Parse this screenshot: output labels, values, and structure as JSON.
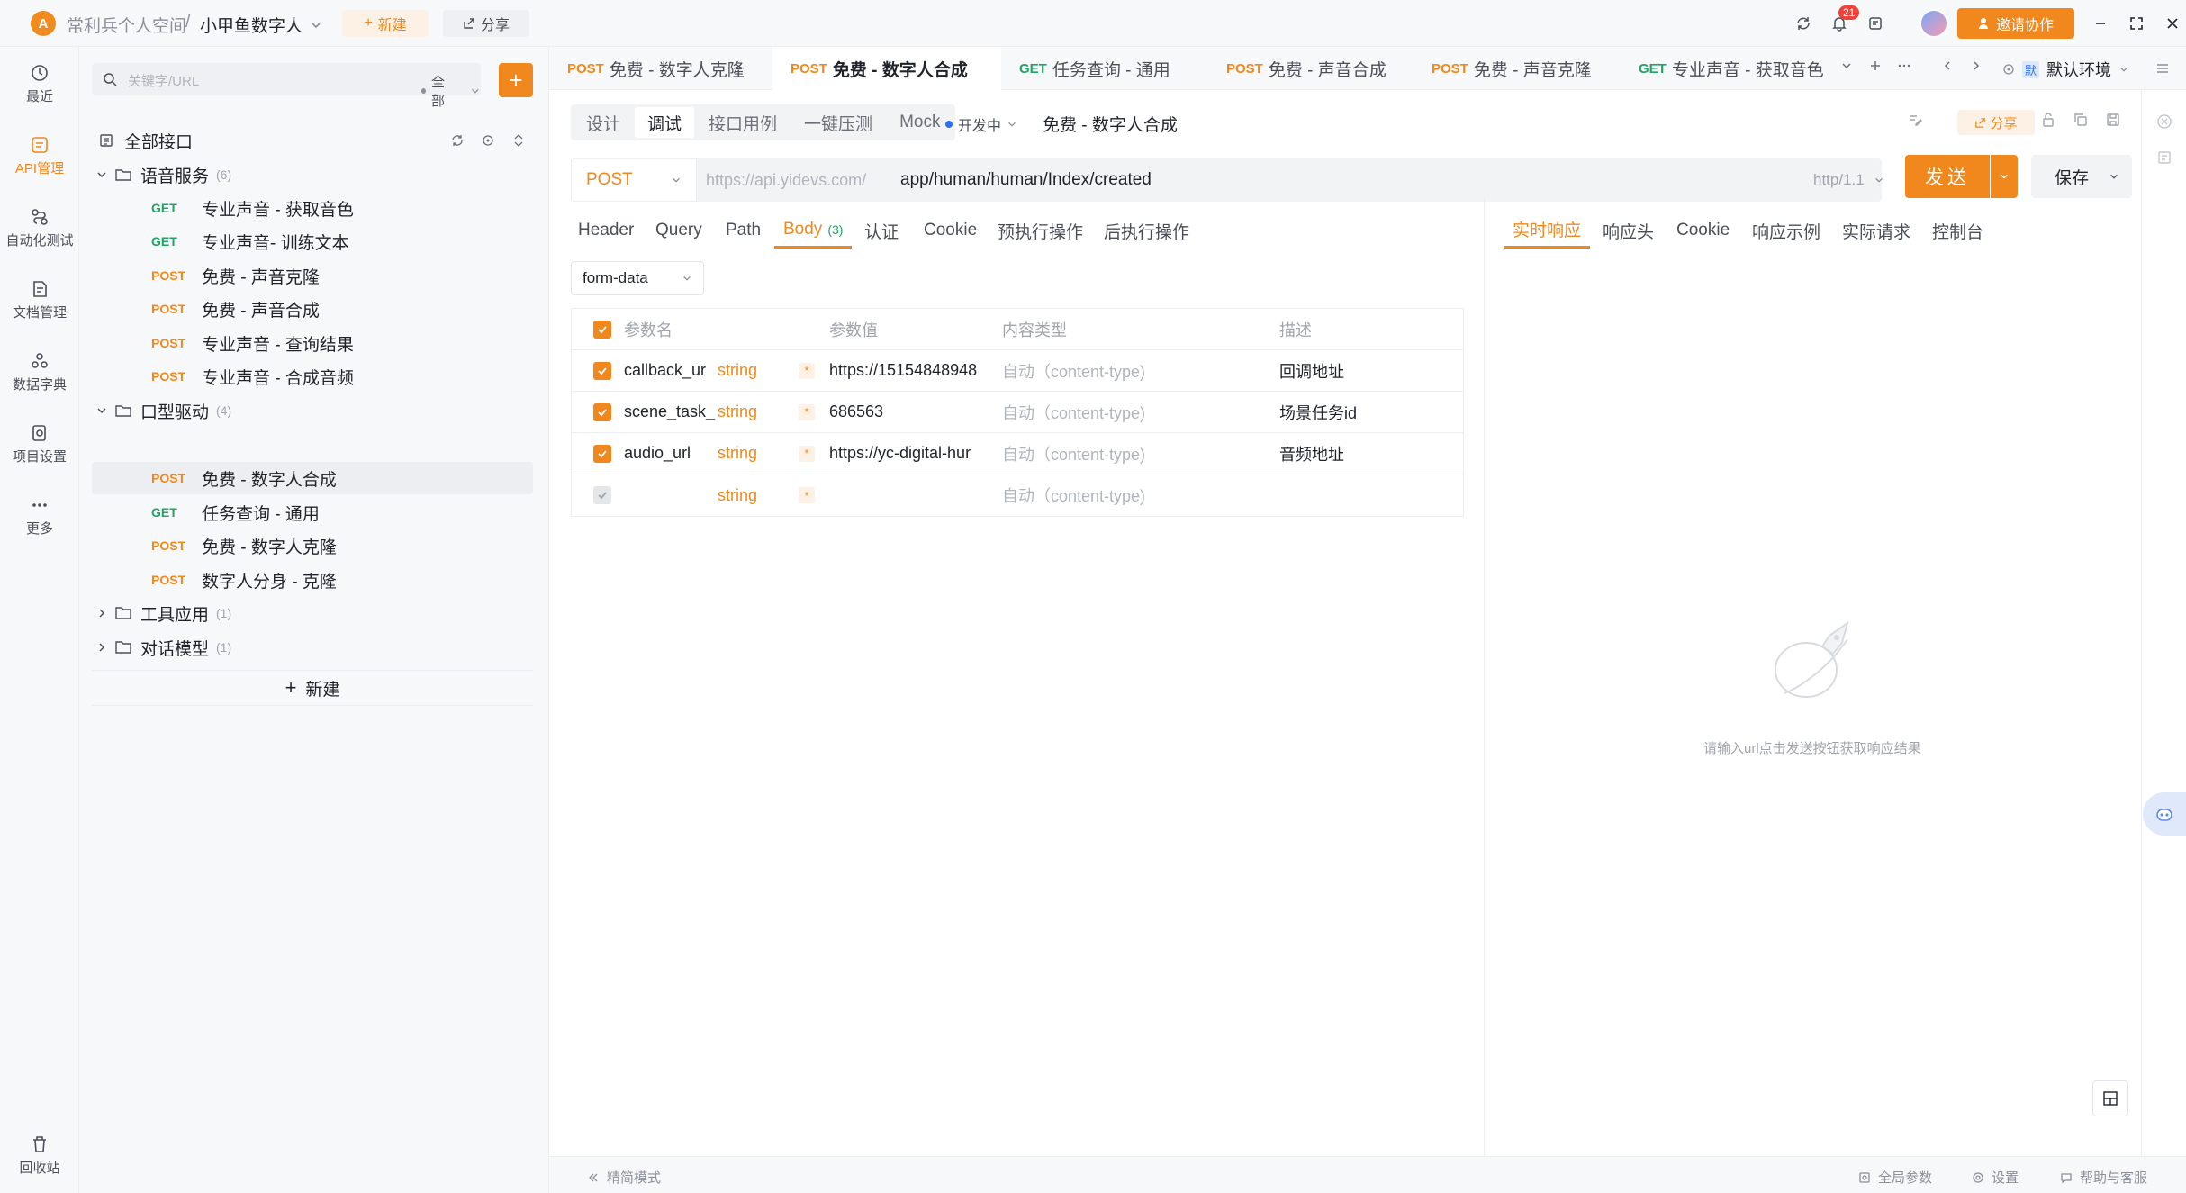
{
  "titlebar": {
    "workspace": "常利兵个人空间",
    "separator": "/",
    "project": "小甲鱼数字人",
    "new_label": "新建",
    "share_label": "分享",
    "notification_count": "21",
    "invite_label": "邀请协作"
  },
  "leftnav": {
    "items": [
      {
        "label": "最近"
      },
      {
        "label": "API管理"
      },
      {
        "label": "自动化测试"
      },
      {
        "label": "文档管理"
      },
      {
        "label": "数据字典"
      },
      {
        "label": "项目设置"
      },
      {
        "label": "更多"
      }
    ],
    "trash": "回收站"
  },
  "sidebar": {
    "search_placeholder": "关键字/URL",
    "scope": "全部",
    "all_label": "全部接口",
    "folders": [
      {
        "name": "语音服务",
        "count": "(6)"
      },
      {
        "name": "口型驱动",
        "count": "(4)"
      },
      {
        "name": "工具应用",
        "count": "(1)"
      },
      {
        "name": "对话模型",
        "count": "(1)"
      }
    ],
    "apis": [
      {
        "method": "GET",
        "name": "专业声音 - 获取音色"
      },
      {
        "method": "GET",
        "name": "专业声音- 训练文本"
      },
      {
        "method": "POST",
        "name": "免费 - 声音克隆"
      },
      {
        "method": "POST",
        "name": "免费 - 声音合成"
      },
      {
        "method": "POST",
        "name": "专业声音 - 查询结果"
      },
      {
        "method": "POST",
        "name": "专业声音 - 合成音频"
      },
      {
        "method": "POST",
        "name": "免费 - 数字人合成"
      },
      {
        "method": "GET",
        "name": "任务查询 - 通用"
      },
      {
        "method": "POST",
        "name": "免费 - 数字人克隆"
      },
      {
        "method": "POST",
        "name": "数字人分身 - 克隆"
      }
    ],
    "new_label": "新建"
  },
  "tabs": [
    {
      "method": "POST",
      "label": "免费 - 数字人克隆"
    },
    {
      "method": "POST",
      "label": "免费 - 数字人合成"
    },
    {
      "method": "GET",
      "label": "任务查询 - 通用"
    },
    {
      "method": "POST",
      "label": "免费 - 声音合成"
    },
    {
      "method": "POST",
      "label": "免费 - 声音克隆"
    },
    {
      "method": "GET",
      "label": "专业声音 - 获取音色"
    }
  ],
  "env": "默认环境",
  "mode_tabs": [
    "设计",
    "调试",
    "接口用例",
    "一键压测",
    "Mock"
  ],
  "status": "开发中",
  "api_name": "免费 - 数字人合成",
  "share_label": "分享",
  "request": {
    "method": "POST",
    "base_url": "https://api.yidevs.com/",
    "path": "app/human/human/Index/created",
    "http_version": "http/1.1",
    "send_label": "发送",
    "save_label": "保存"
  },
  "req_tabs": [
    "Header",
    "Query",
    "Path",
    "Body",
    "认证",
    "Cookie",
    "预执行操作",
    "后执行操作"
  ],
  "body_count": "(3)",
  "body_type": "form-data",
  "params_header": {
    "name": "参数名",
    "value": "参数值",
    "content_type": "内容类型",
    "desc": "描述"
  },
  "params": [
    {
      "name": "callback_ur",
      "type": "string",
      "value": "https://15154848948",
      "content_type": "自动（content-type)",
      "desc": "回调地址"
    },
    {
      "name": "scene_task_",
      "type": "string",
      "value": "686563",
      "content_type": "自动（content-type)",
      "desc": "场景任务id"
    },
    {
      "name": "audio_url",
      "type": "string",
      "value": "https://yc-digital-hur",
      "content_type": "自动（content-type)",
      "desc": "音频地址"
    },
    {
      "name": "",
      "type": "string",
      "value": "",
      "content_type": "自动（content-type)",
      "desc": ""
    }
  ],
  "resp_tabs": [
    "实时响应",
    "响应头",
    "Cookie",
    "响应示例",
    "实际请求",
    "控制台"
  ],
  "resp_hint": "请输入url点击发送按钮获取响应结果",
  "footer": {
    "simple_mode": "精简模式",
    "global_params": "全局参数",
    "settings": "设置",
    "help": "帮助与客服"
  },
  "colors": {
    "accent": "#f0881d",
    "get": "#21a366",
    "post": "#f0881d"
  }
}
